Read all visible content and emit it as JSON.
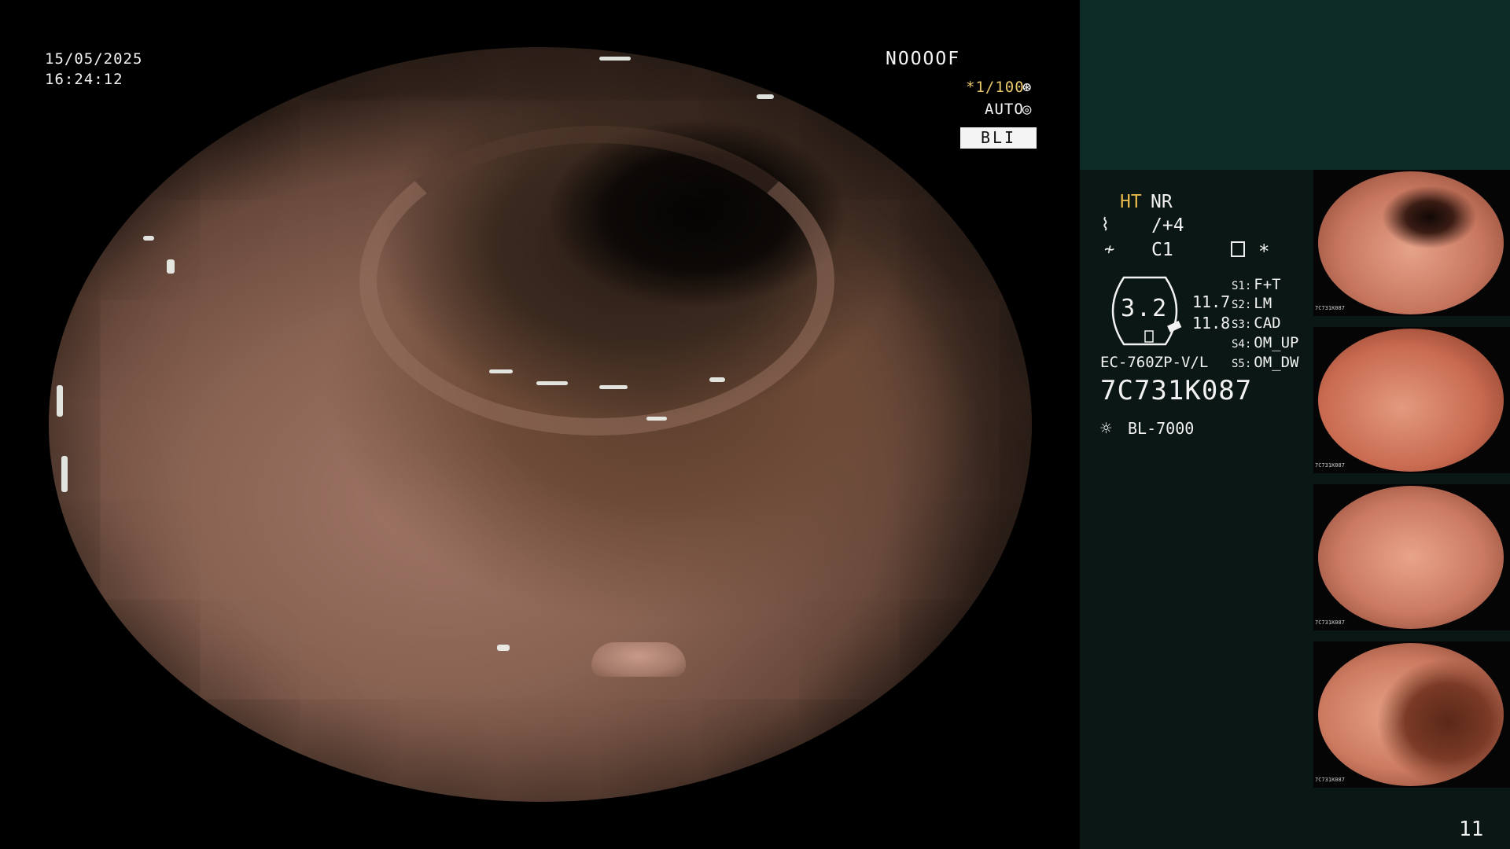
{
  "overlay": {
    "date": "15/05/2025",
    "time": "16:24:12",
    "mode_code": "NOOOOF",
    "shutter": "*1/100",
    "shutter_icon": "shutter-icon",
    "auto": "AUTO",
    "auto_icon": "iris-icon",
    "mode_badge": "BLI"
  },
  "panel": {
    "ht": "HT",
    "nr": "NR",
    "enhancement_icon": "enhancement-icon",
    "enhancement": "/+4",
    "color_icon": "color-icon",
    "color": "C1",
    "record_star": "*",
    "zoom_value": "3.2",
    "zoom_a": "11.7",
    "zoom_b": "11.8",
    "switches": [
      {
        "key": "S1:",
        "value": "F+T"
      },
      {
        "key": "S2:",
        "value": "LM"
      },
      {
        "key": "S3:",
        "value": "CAD"
      },
      {
        "key": "S4:",
        "value": "OM_UP"
      },
      {
        "key": "S5:",
        "value": "OM_DW"
      }
    ],
    "scope_model": "EC-760ZP-V/L",
    "scope_serial": "7C731K087",
    "light_icon": "sun-icon",
    "light_source": "BL-7000",
    "image_count": "11"
  },
  "thumbnails": [
    {
      "label": "7C731K087"
    },
    {
      "label": "7C731K087"
    },
    {
      "label": "7C731K087"
    },
    {
      "label": "7C731K087"
    }
  ]
}
